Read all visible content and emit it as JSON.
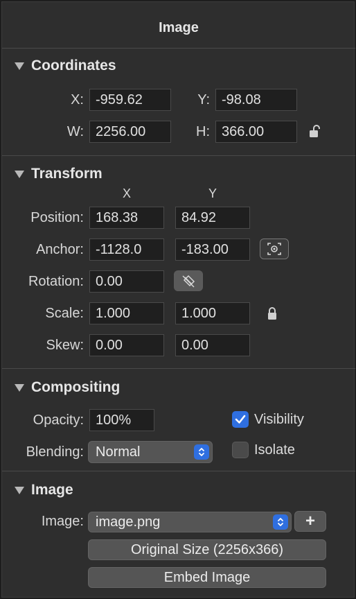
{
  "panel_title": "Image",
  "coordinates": {
    "header": "Coordinates",
    "x_label": "X:",
    "x_value": "-959.62",
    "y_label": "Y:",
    "y_value": "-98.08",
    "w_label": "W:",
    "w_value": "2256.00",
    "h_label": "H:",
    "h_value": "366.00",
    "lock_icon": "unlocked-padlock-icon"
  },
  "transform": {
    "header": "Transform",
    "col_x": "X",
    "col_y": "Y",
    "position_label": "Position:",
    "position_x": "168.38",
    "position_y": "84.92",
    "anchor_label": "Anchor:",
    "anchor_x": "-1128.0",
    "anchor_y": "-183.00",
    "anchor_icon": "target-icon",
    "rotation_label": "Rotation:",
    "rotation_value": "0.00",
    "rotation_icon": "rotation-reset-icon",
    "scale_label": "Scale:",
    "scale_x": "1.000",
    "scale_y": "1.000",
    "scale_lock_icon": "locked-padlock-icon",
    "skew_label": "Skew:",
    "skew_x": "0.00",
    "skew_y": "0.00"
  },
  "compositing": {
    "header": "Compositing",
    "opacity_label": "Opacity:",
    "opacity_value": "100%",
    "blending_label": "Blending:",
    "blending_value": "Normal",
    "visibility_label": "Visibility",
    "visibility_checked": true,
    "isolate_label": "Isolate",
    "isolate_checked": false
  },
  "image": {
    "header": "Image",
    "image_label": "Image:",
    "image_value": "image.png",
    "add_button": "+",
    "original_size_button": "Original Size (2256x366)",
    "embed_button": "Embed Image"
  },
  "colors": {
    "accent": "#2f6fe0",
    "panel_bg": "#2e2e2e",
    "field_bg": "#1f1f1f"
  }
}
